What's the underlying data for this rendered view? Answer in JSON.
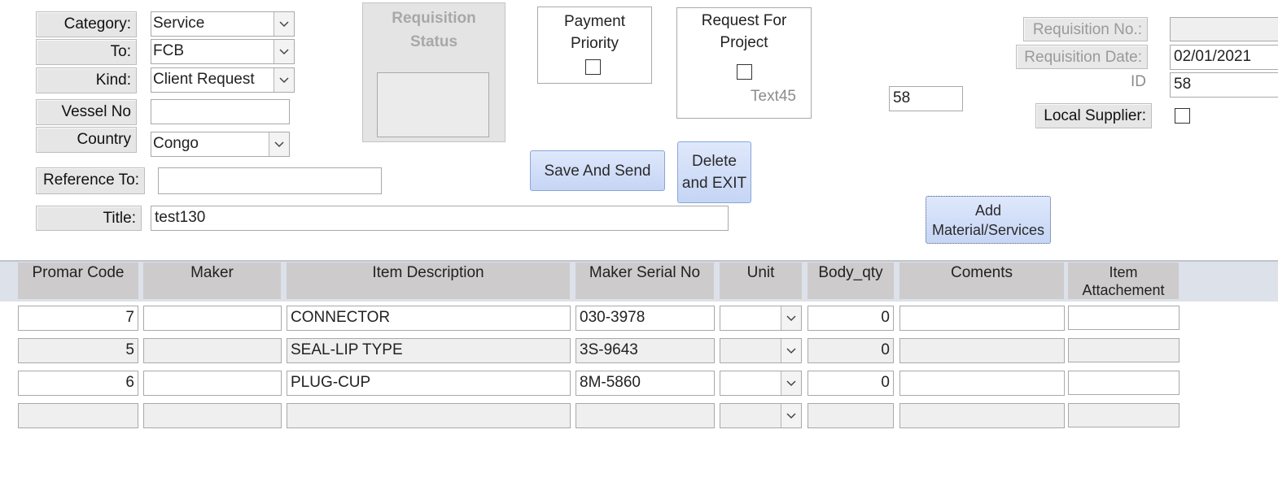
{
  "form": {
    "category": {
      "label": "Category:",
      "value": "Service"
    },
    "to": {
      "label": "To:",
      "value": "FCB"
    },
    "kind": {
      "label": "Kind:",
      "value": "Client Request"
    },
    "vessel_no": {
      "label": "Vessel No",
      "value": ""
    },
    "country": {
      "label": "Country",
      "value": "Congo"
    },
    "reference_to": {
      "label": "Reference To:",
      "value": ""
    },
    "title": {
      "label": "Title:",
      "value": "test130"
    }
  },
  "requisition_status": {
    "label_line1": "Requisition",
    "label_line2": "Status"
  },
  "payment_priority": {
    "line1": "Payment",
    "line2": "Priority",
    "checked": false
  },
  "request_for_project": {
    "line1": "Request For",
    "line2": "Project",
    "checked": false,
    "text45": "Text45"
  },
  "mid_field_value": "58",
  "right": {
    "requisition_no": {
      "label": "Requisition No.:",
      "value": ""
    },
    "requisition_date": {
      "label": "Requisition Date:",
      "value": "02/01/2021"
    },
    "id": {
      "label": "ID",
      "value": "58"
    },
    "local_supplier": {
      "label": "Local Supplier:",
      "checked": false
    }
  },
  "buttons": {
    "save_and_send": "Save And Send",
    "delete_exit_line1": "Delete",
    "delete_exit_line2": "and EXIT",
    "add_material_line1": "Add",
    "add_material_line2": "Material/Services"
  },
  "grid": {
    "columns": [
      "Promar Code",
      "Maker",
      "Item Description",
      "Maker Serial No",
      "Unit",
      "Body_qty",
      "Coments"
    ],
    "attachment_col_line1": "Item",
    "attachment_col_line2": "Attachement",
    "rows": [
      {
        "code": "7",
        "maker": "",
        "desc": "CONNECTOR",
        "serial": "030-3978",
        "unit": "",
        "qty": "0",
        "comments": "",
        "attach": ""
      },
      {
        "code": "5",
        "maker": "",
        "desc": "SEAL-LIP TYPE",
        "serial": "3S-9643",
        "unit": "",
        "qty": "0",
        "comments": "",
        "attach": ""
      },
      {
        "code": "6",
        "maker": "",
        "desc": "PLUG-CUP",
        "serial": "8M-5860",
        "unit": "",
        "qty": "0",
        "comments": "",
        "attach": ""
      },
      {
        "code": "",
        "maker": "",
        "desc": "",
        "serial": "",
        "unit": "",
        "qty": "",
        "comments": "",
        "attach": ""
      }
    ]
  },
  "icons": {
    "dropdown": "chevron-down-icon",
    "checkbox": "checkbox-icon"
  }
}
